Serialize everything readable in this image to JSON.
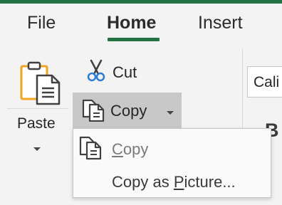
{
  "tabs": {
    "file": "File",
    "home": "Home",
    "insert": "Insert"
  },
  "clipboard": {
    "paste_label": "Paste",
    "cut_label": "Cut",
    "copy_label": "Copy"
  },
  "font": {
    "name_partial": "Cali",
    "bold_glyph": "B"
  },
  "copy_menu": {
    "copy": {
      "mnemonic": "C",
      "rest": "opy"
    },
    "copy_as_picture": {
      "before": "Copy as ",
      "mnemonic": "P",
      "after": "icture..."
    }
  },
  "colors": {
    "accent_green": "#217346",
    "copy_button_bg": "#c8c8c8",
    "paste_clipboard_orange": "#f2a31f"
  },
  "icons": [
    "paste-icon",
    "chevron-down-icon",
    "scissors-icon",
    "copy-icon"
  ]
}
